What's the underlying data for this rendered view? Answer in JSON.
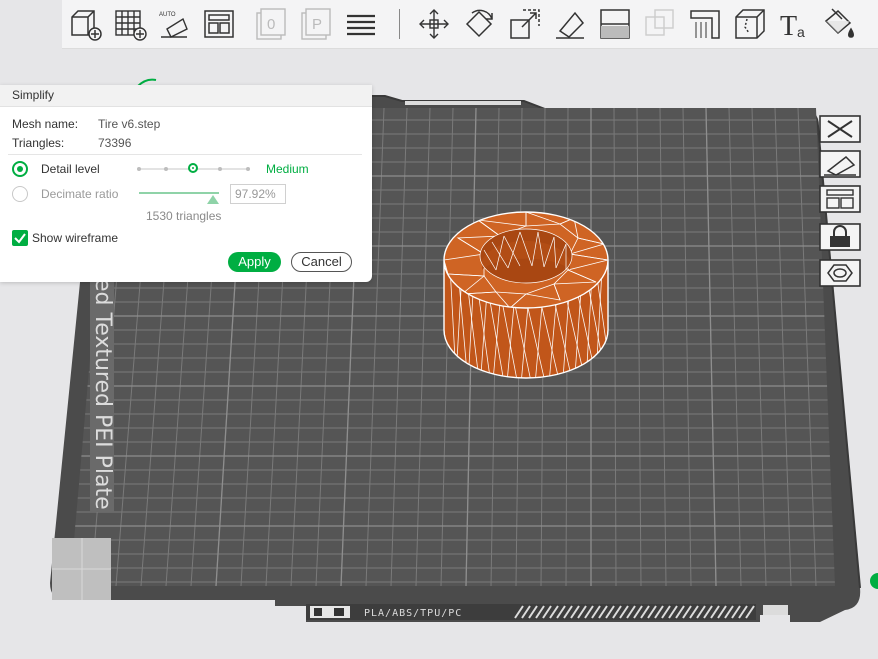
{
  "dialog": {
    "title": "Simplify",
    "mesh_name_label": "Mesh name:",
    "mesh_name": "Tire v6.step",
    "triangles_label": "Triangles:",
    "triangles": "73396",
    "detail_level_label": "Detail level",
    "detail_level_value": "Medium",
    "decimate_ratio_label": "Decimate ratio",
    "decimate_ratio": "97.92%",
    "decimate_fraction": 0.9792,
    "resulting_triangles": "1530 triangles",
    "show_wireframe_label": "Show wireframe",
    "show_wireframe": true,
    "apply_label": "Apply",
    "cancel_label": "Cancel"
  },
  "plate": {
    "label": "ed Textured PEI Plate",
    "filaments_label": "PLA/ABS/TPU/PC"
  },
  "toolbar": {
    "items": [
      "add-cube-icon",
      "add-plate-icon",
      "auto-orient-icon",
      "arrange-icon",
      "slice-plate-icon",
      "print-plate-icon",
      "layers-icon",
      "move-icon",
      "rotate-icon",
      "scale-icon",
      "lay-on-face-icon",
      "cut-icon",
      "boolean-icon",
      "support-paint-icon",
      "seam-paint-icon",
      "text-icon",
      "color-paint-icon"
    ]
  },
  "side_tools": [
    "close-icon",
    "auto-orient-icon",
    "arrange-icon",
    "lock-icon",
    "hex-nut-icon"
  ],
  "colors": {
    "accent": "#00ae42",
    "plate": "#4a4a4a",
    "model": "#c85a1c"
  }
}
